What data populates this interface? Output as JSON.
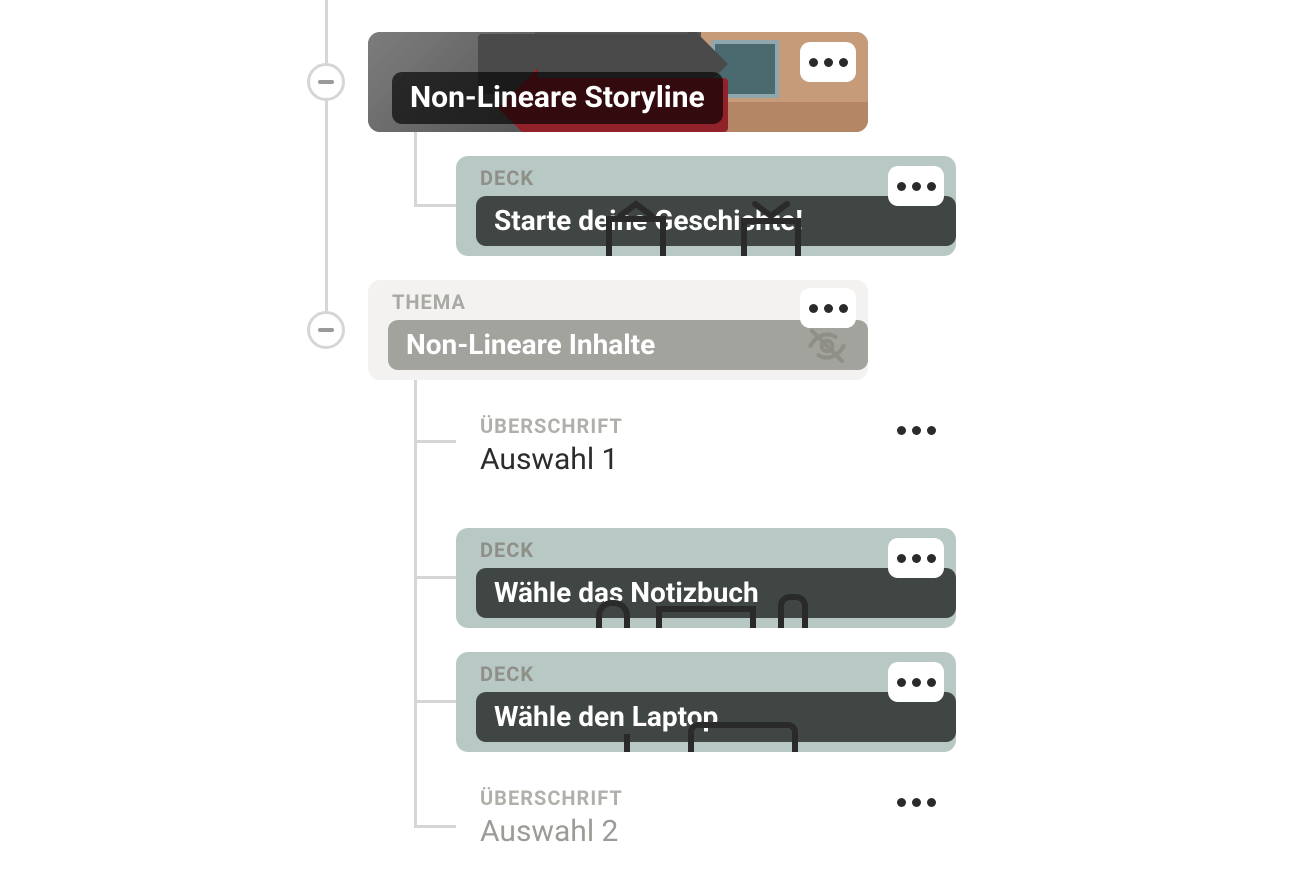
{
  "tree": {
    "root": {
      "title": "Non-Lineare Storyline",
      "children": [
        {
          "type_label": "DECK",
          "title": "Starte deine Geschichte!"
        },
        {
          "type_label": "THEMA",
          "title": "Non-Lineare Inhalte",
          "hidden": true,
          "children": [
            {
              "type_label": "ÜBERSCHRIFT",
              "title": "Auswahl 1",
              "children": [
                {
                  "type_label": "DECK",
                  "title": "Wähle das Notizbuch"
                },
                {
                  "type_label": "DECK",
                  "title": "Wähle den Laptop"
                }
              ]
            },
            {
              "type_label": "ÜBERSCHRIFT",
              "title": "Auswahl 2"
            }
          ]
        }
      ]
    }
  }
}
